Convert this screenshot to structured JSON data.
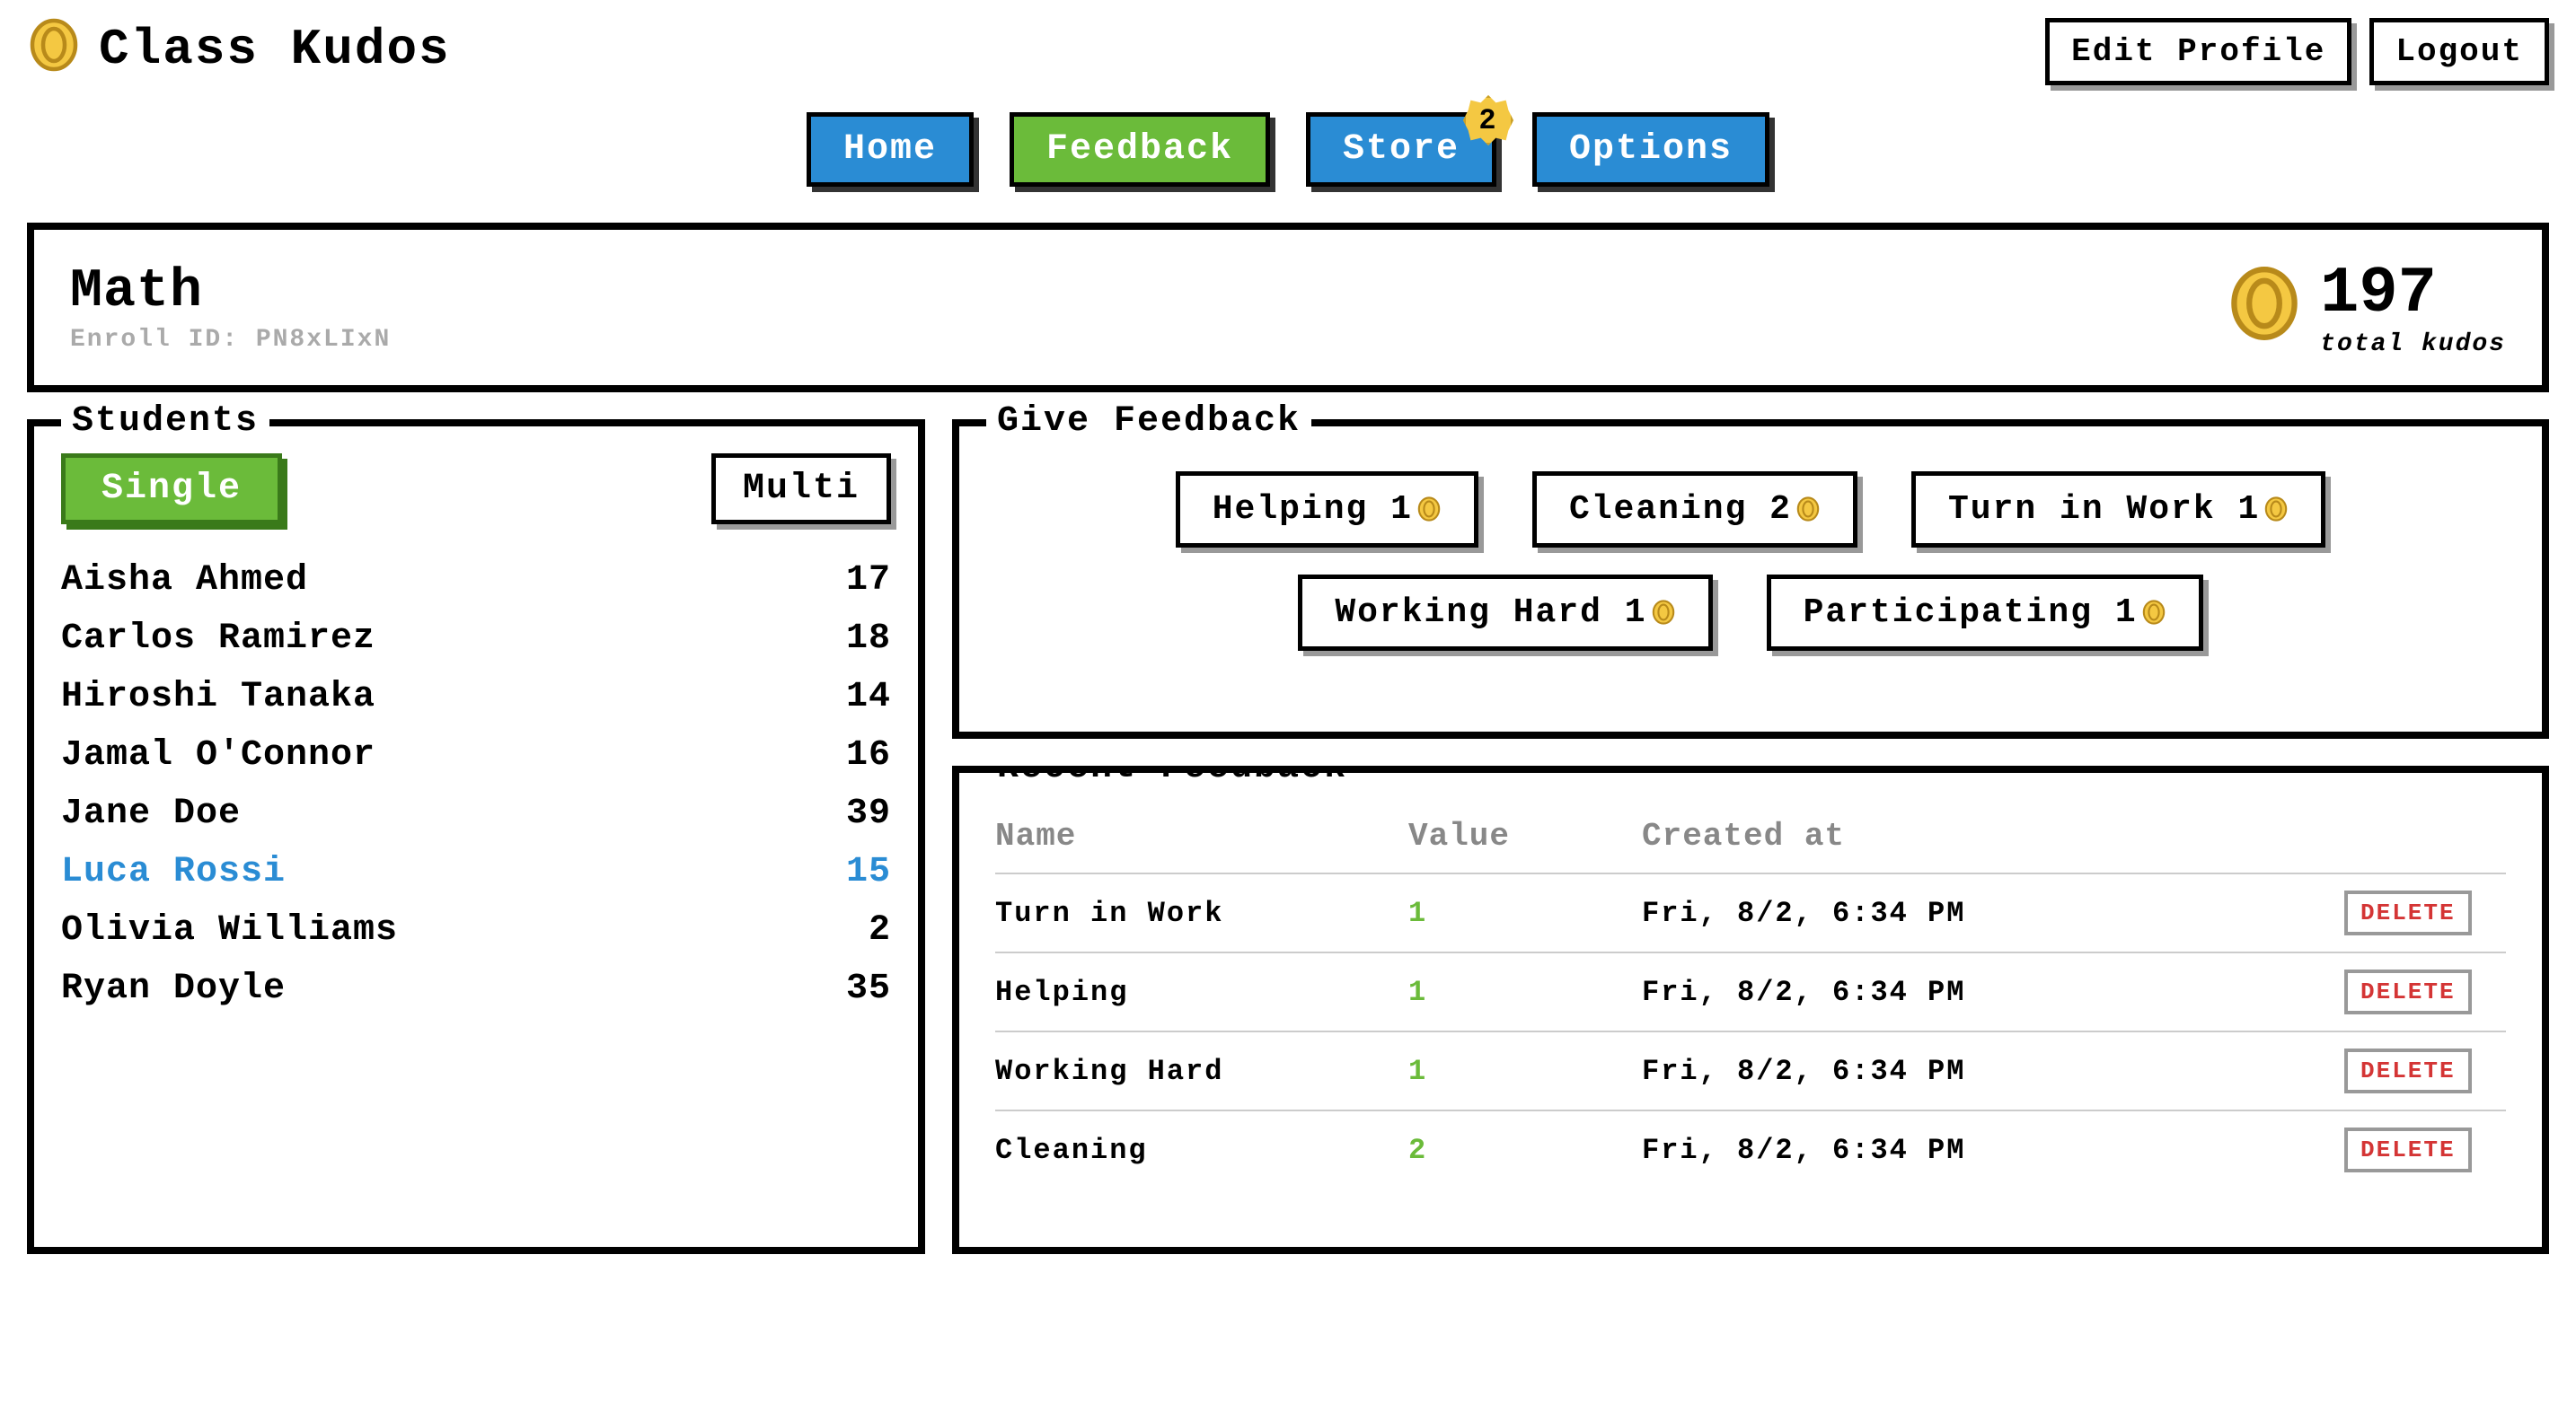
{
  "app": {
    "title": "Class Kudos"
  },
  "header": {
    "edit_profile": "Edit Profile",
    "logout": "Logout"
  },
  "nav": {
    "home": "Home",
    "feedback": "Feedback",
    "store": "Store",
    "store_badge": "2",
    "options": "Options"
  },
  "class": {
    "name": "Math",
    "enroll_label": "Enroll ID: PN8xLIxN",
    "total_kudos": "197",
    "total_label": "total kudos"
  },
  "students": {
    "legend": "Students",
    "single": "Single",
    "multi": "Multi",
    "list": [
      {
        "name": "Aisha Ahmed",
        "score": "17",
        "selected": false
      },
      {
        "name": "Carlos Ramirez",
        "score": "18",
        "selected": false
      },
      {
        "name": "Hiroshi Tanaka",
        "score": "14",
        "selected": false
      },
      {
        "name": "Jamal O'Connor",
        "score": "16",
        "selected": false
      },
      {
        "name": "Jane Doe",
        "score": "39",
        "selected": false
      },
      {
        "name": "Luca Rossi",
        "score": "15",
        "selected": true
      },
      {
        "name": "Olivia Williams",
        "score": "2",
        "selected": false
      },
      {
        "name": "Ryan Doyle",
        "score": "35",
        "selected": false
      }
    ]
  },
  "give_feedback": {
    "legend": "Give Feedback",
    "options": [
      {
        "label": "Helping",
        "value": "1"
      },
      {
        "label": "Cleaning",
        "value": "2"
      },
      {
        "label": "Turn in Work",
        "value": "1"
      },
      {
        "label": "Working Hard",
        "value": "1"
      },
      {
        "label": "Participating",
        "value": "1"
      }
    ]
  },
  "recent": {
    "legend": "Recent Feedback",
    "headers": {
      "name": "Name",
      "value": "Value",
      "created": "Created at"
    },
    "rows": [
      {
        "name": "Turn in Work",
        "value": "1",
        "created": "Fri, 8/2, 6:34 PM",
        "action": "DELETE"
      },
      {
        "name": "Helping",
        "value": "1",
        "created": "Fri, 8/2, 6:34 PM",
        "action": "DELETE"
      },
      {
        "name": "Working Hard",
        "value": "1",
        "created": "Fri, 8/2, 6:34 PM",
        "action": "DELETE"
      },
      {
        "name": "Cleaning",
        "value": "2",
        "created": "Fri, 8/2, 6:34 PM",
        "action": "DELETE"
      }
    ]
  }
}
